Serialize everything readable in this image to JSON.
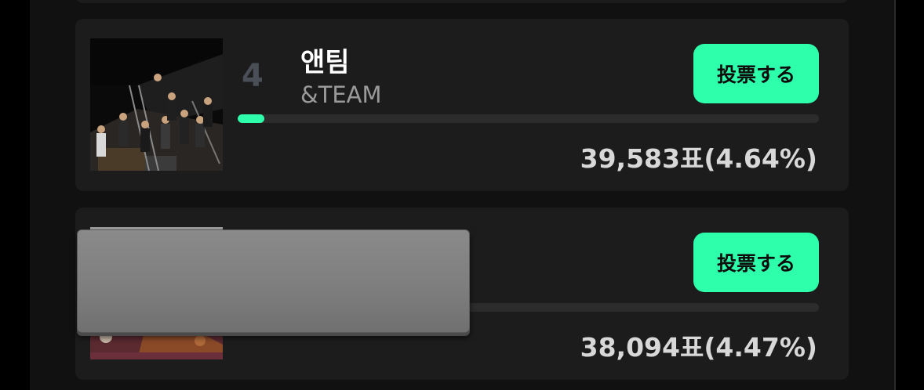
{
  "entries": [
    {
      "rank": "4",
      "name": "앤팀",
      "sub": "&TEAM",
      "vote_label": "投票する",
      "votes": "39,583",
      "unit": "표",
      "percent": "(4.64%)",
      "share": 0.0464
    },
    {
      "rank": "",
      "name": "",
      "sub": "",
      "vote_label": "投票する",
      "votes": "38,094",
      "unit": "표",
      "percent": "(4.47%)",
      "share": 0.0447
    }
  ],
  "colors": {
    "accent": "#2effaa",
    "card": "#1c1c1c",
    "background": "#111111"
  }
}
